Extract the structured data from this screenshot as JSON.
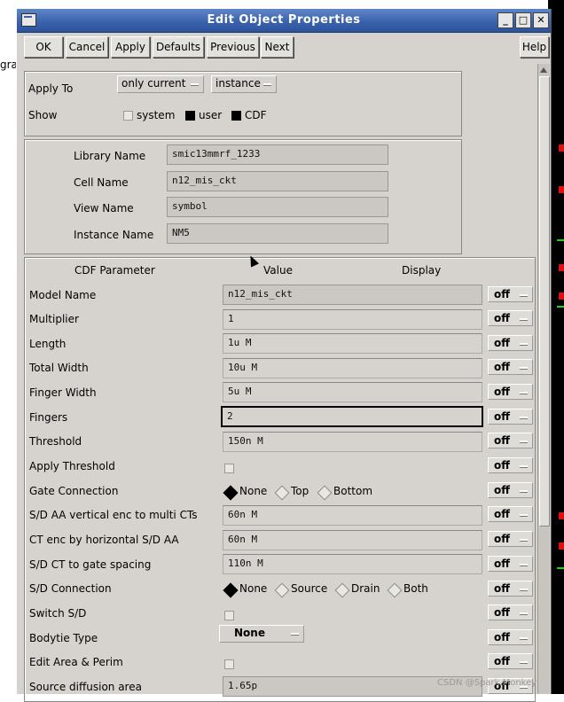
{
  "window": {
    "title": "Edit Object Properties",
    "minimize": "_",
    "maximize": "□",
    "close": "✕"
  },
  "background": {
    "left_text": "gra"
  },
  "toolbar": {
    "ok": "OK",
    "cancel": "Cancel",
    "apply": "Apply",
    "defaults": "Defaults",
    "previous": "Previous",
    "next": "Next",
    "help": "Help"
  },
  "apply_to": {
    "label": "Apply To",
    "scope": "only current",
    "target": "instance"
  },
  "show": {
    "label": "Show",
    "system": "system",
    "system_checked": false,
    "user": "user",
    "user_checked": true,
    "cdf": "CDF",
    "cdf_checked": true
  },
  "names": {
    "library_label": "Library Name",
    "library_value": "smic13mmrf_1233",
    "cell_label": "Cell Name",
    "cell_value": "n12_mis_ckt",
    "view_label": "View Name",
    "view_value": "symbol",
    "instance_label": "Instance Name",
    "instance_value": "NM5"
  },
  "cdf": {
    "col_param": "CDF Parameter",
    "col_value": "Value",
    "col_display": "Display",
    "rows": [
      {
        "label": "Model Name",
        "value": "n12_mis_ckt",
        "display": "off"
      },
      {
        "label": "Multiplier",
        "value": "1",
        "display": "off"
      },
      {
        "label": "Length",
        "value": "1u M",
        "display": "off"
      },
      {
        "label": "Total Width",
        "value": "10u M",
        "display": "off"
      },
      {
        "label": "Finger Width",
        "value": "5u M",
        "display": "off"
      },
      {
        "label": "Fingers",
        "value": "2",
        "display": "off"
      },
      {
        "label": "Threshold",
        "value": "150n M",
        "display": "off"
      },
      {
        "label": "Apply Threshold",
        "checked": false,
        "display": "off"
      },
      {
        "label": "Gate Connection",
        "options": [
          "None",
          "Top",
          "Bottom"
        ],
        "selected": "None",
        "display": "off"
      },
      {
        "label": "S/D AA vertical enc to multi CTs",
        "value": "60n M",
        "display": "off"
      },
      {
        "label": "CT enc by horizontal S/D AA",
        "value": "60n M",
        "display": "off"
      },
      {
        "label": "S/D CT to gate spacing",
        "value": "110n M",
        "display": "off"
      },
      {
        "label": "S/D Connection",
        "options": [
          "None",
          "Source",
          "Drain",
          "Both"
        ],
        "selected": "None",
        "display": "off"
      },
      {
        "label": "Switch S/D",
        "checked": false,
        "display": "off"
      },
      {
        "label": "Bodytie Type",
        "value": "None",
        "display": "off"
      },
      {
        "label": "Edit Area & Perim",
        "checked": false,
        "display": "off"
      },
      {
        "label": "Source diffusion area",
        "value": "1.65p",
        "display": "off"
      }
    ]
  },
  "watermark": "CSDN @Spark Monkey"
}
